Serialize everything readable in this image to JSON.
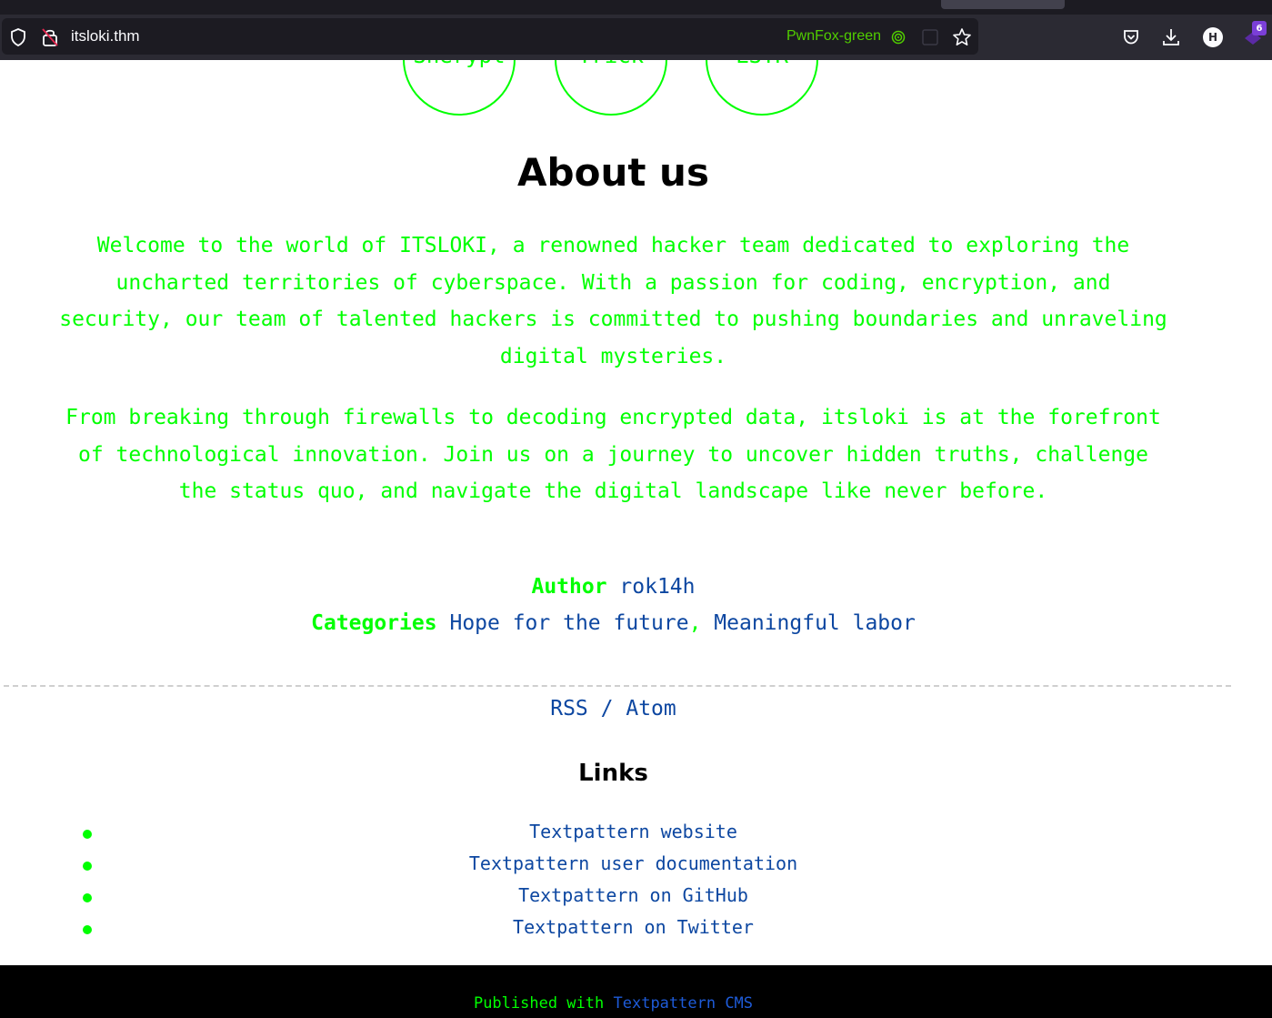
{
  "browser": {
    "url": "itsloki.thm",
    "container_label": "PwnFox-green",
    "extension_badge": "6",
    "profile_initial": "H"
  },
  "stats": [
    "Snerypt",
    "Trick",
    "LSTR"
  ],
  "about": {
    "title": "About us",
    "para1": "Welcome to the world of ITSLOKI, a renowned hacker team dedicated to exploring the uncharted territories of cyberspace. With a passion for coding, encryption, and security, our team of talented hackers is committed to pushing boundaries and unraveling digital mysteries.",
    "para2": "From breaking through firewalls to decoding encrypted data, itsloki is at the forefront of technological innovation. Join us on a journey to uncover hidden truths, challenge the status quo, and navigate the digital landscape like never before."
  },
  "meta": {
    "author_label": "Author",
    "author": "rok14h",
    "categories_label": "Categories",
    "category1": "Hope for the future",
    "separator": ",",
    "category2": "Meaningful labor"
  },
  "feeds": {
    "rss": "RSS",
    "slash": "/",
    "atom": "Atom"
  },
  "links": {
    "title": "Links",
    "items": [
      "Textpattern website",
      "Textpattern user documentation",
      "Textpattern on GitHub",
      "Textpattern on Twitter"
    ]
  },
  "footer": {
    "prefix": "Published with",
    "link": "Textpattern CMS"
  },
  "colors": {
    "accent_green": "#00ff00",
    "link_blue": "#0d47a1"
  }
}
